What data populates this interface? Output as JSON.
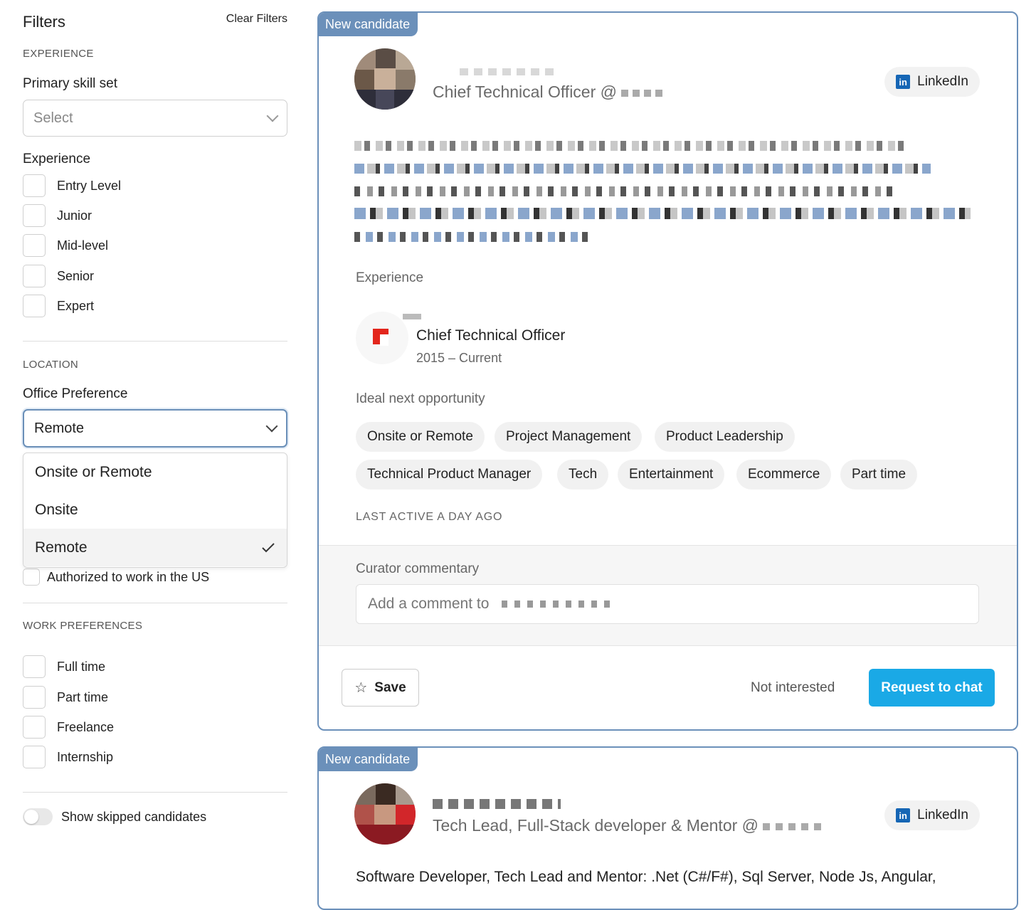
{
  "filters": {
    "title": "Filters",
    "clear_label": "Clear Filters",
    "experience_section": "EXPERIENCE",
    "primary_skill_label": "Primary skill set",
    "primary_skill_placeholder": "Select",
    "experience_label": "Experience",
    "experience_options": [
      "Entry Level",
      "Junior",
      "Mid-level",
      "Senior",
      "Expert"
    ],
    "location_section": "LOCATION",
    "office_pref_label": "Office Preference",
    "office_pref_value": "Remote",
    "office_pref_options": [
      "Onsite or Remote",
      "Onsite",
      "Remote"
    ],
    "office_pref_selected_index": 2,
    "authorized_label": "Authorized to work in the US",
    "work_pref_section": "WORK PREFERENCES",
    "work_pref_options": [
      "Full time",
      "Part time",
      "Freelance",
      "Internship"
    ],
    "show_skipped_label": "Show skipped candidates",
    "show_skipped_on": false
  },
  "candidates": [
    {
      "badge": "New candidate",
      "headline": "Chief Technical Officer @",
      "linkedin_label": "LinkedIn",
      "experience_heading": "Experience",
      "job_title": "Chief Technical Officer",
      "job_dates": "2015 – Current",
      "opportunity_heading": "Ideal next opportunity",
      "tags": [
        "Onsite or Remote",
        "Project Management",
        "Product Leadership",
        "Technical Product Manager",
        "Tech",
        "Entertainment",
        "Ecommerce",
        "Part time"
      ],
      "last_active": "LAST ACTIVE A DAY AGO",
      "curator_label": "Curator commentary",
      "comment_placeholder": "Add a comment to",
      "save_label": "Save",
      "not_interested_label": "Not interested",
      "request_chat_label": "Request to chat"
    },
    {
      "badge": "New candidate",
      "headline": "Tech Lead, Full-Stack developer & Mentor @",
      "linkedin_label": "LinkedIn",
      "summary": "Software Developer, Tech Lead and Mentor: .Net (C#/F#), Sql Server, Node Js, Angular,"
    }
  ],
  "colors": {
    "accent_blue": "#6b90ba",
    "request_button": "#1aa9e6",
    "linkedin_blue": "#1666b5"
  }
}
